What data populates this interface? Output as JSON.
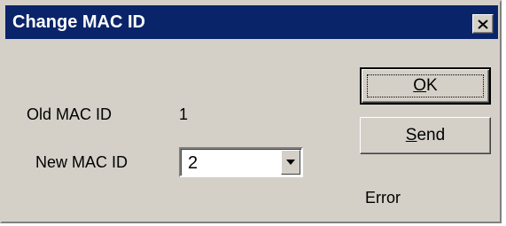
{
  "window": {
    "title": "Change MAC ID",
    "close_icon": "close-icon"
  },
  "form": {
    "old_mac_label": "Old MAC ID",
    "old_mac_value": "1",
    "new_mac_label": "New MAC ID",
    "new_mac_value": "2"
  },
  "buttons": {
    "ok_label": "OK",
    "ok_mnemonic": "O",
    "ok_rest": "K",
    "send_label": "Send",
    "send_mnemonic": "S",
    "send_rest": "end"
  },
  "status": {
    "text": "Error"
  },
  "colors": {
    "titlebar": "#0a246a",
    "face": "#d4d0c8"
  }
}
